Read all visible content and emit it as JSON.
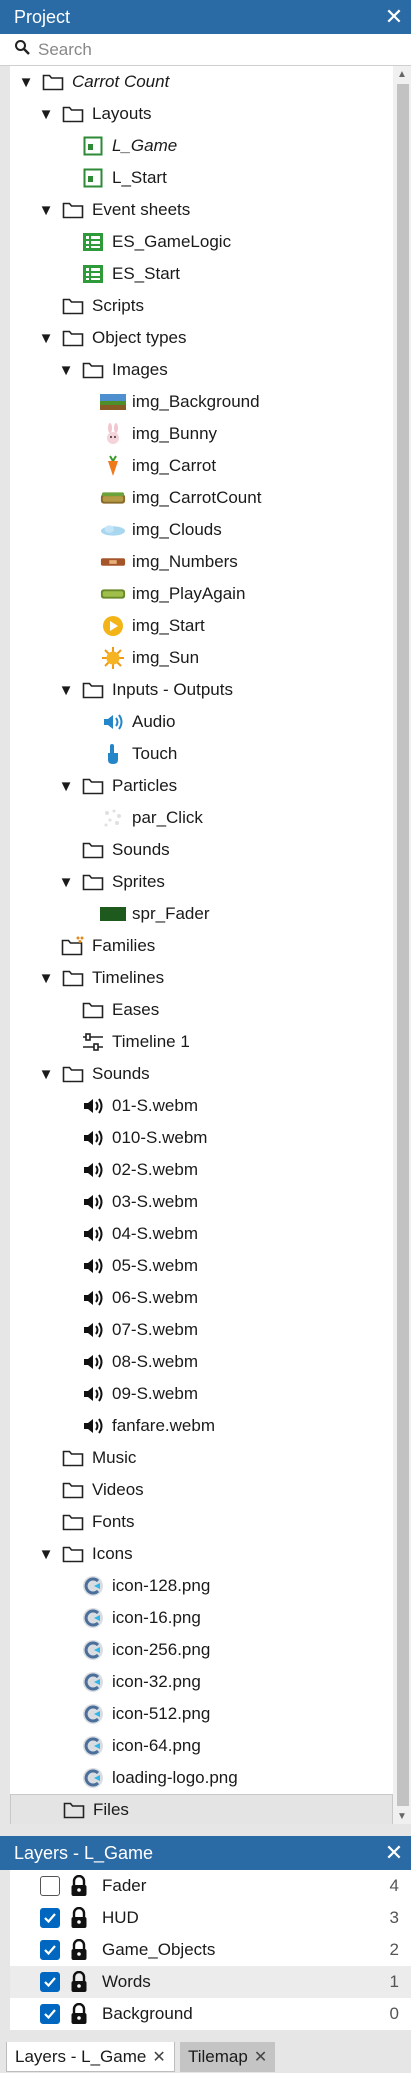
{
  "project_panel": {
    "title": "Project",
    "close_glyph": "✕",
    "search": {
      "placeholder": "Search",
      "value": ""
    }
  },
  "tree": [
    {
      "label": "Carrot Count",
      "icon": "folder-icon",
      "expanded": true,
      "italic": true
    },
    {
      "label": "Layouts",
      "icon": "folder-icon",
      "expanded": true
    },
    {
      "label": "L_Game",
      "icon": "layout-icon",
      "italic": true
    },
    {
      "label": "L_Start",
      "icon": "layout-icon"
    },
    {
      "label": "Event sheets",
      "icon": "folder-icon",
      "expanded": true
    },
    {
      "label": "ES_GameLogic",
      "icon": "event-sheet-icon"
    },
    {
      "label": "ES_Start",
      "icon": "event-sheet-icon"
    },
    {
      "label": "Scripts",
      "icon": "folder-icon"
    },
    {
      "label": "Object types",
      "icon": "folder-icon",
      "expanded": true
    },
    {
      "label": "Images",
      "icon": "folder-icon",
      "expanded": true
    },
    {
      "label": "img_Background",
      "icon": "background-thumbnail-icon"
    },
    {
      "label": "img_Bunny",
      "icon": "bunny-thumbnail-icon"
    },
    {
      "label": "img_Carrot",
      "icon": "carrot-thumbnail-icon"
    },
    {
      "label": "img_CarrotCount",
      "icon": "carrot-count-thumbnail-icon"
    },
    {
      "label": "img_Clouds",
      "icon": "clouds-thumbnail-icon"
    },
    {
      "label": "img_Numbers",
      "icon": "numbers-thumbnail-icon"
    },
    {
      "label": "img_PlayAgain",
      "icon": "play-again-thumbnail-icon"
    },
    {
      "label": "img_Start",
      "icon": "start-thumbnail-icon"
    },
    {
      "label": "img_Sun",
      "icon": "sun-thumbnail-icon"
    },
    {
      "label": "Inputs - Outputs",
      "icon": "folder-icon",
      "expanded": true
    },
    {
      "label": "Audio",
      "icon": "speaker-icon"
    },
    {
      "label": "Touch",
      "icon": "touch-icon"
    },
    {
      "label": "Particles",
      "icon": "folder-icon",
      "expanded": true
    },
    {
      "label": "par_Click",
      "icon": "particles-icon"
    },
    {
      "label": "Sounds",
      "icon": "folder-icon"
    },
    {
      "label": "Sprites",
      "icon": "folder-icon",
      "expanded": true
    },
    {
      "label": "spr_Fader",
      "icon": "fader-thumbnail-icon"
    },
    {
      "label": "Families",
      "icon": "families-folder-icon"
    },
    {
      "label": "Timelines",
      "icon": "folder-icon",
      "expanded": true
    },
    {
      "label": "Eases",
      "icon": "folder-icon"
    },
    {
      "label": "Timeline 1",
      "icon": "timeline-icon"
    },
    {
      "label": "Sounds",
      "icon": "folder-icon",
      "expanded": true
    },
    {
      "label": "01-S.webm",
      "icon": "sound-file-icon"
    },
    {
      "label": "010-S.webm",
      "icon": "sound-file-icon"
    },
    {
      "label": "02-S.webm",
      "icon": "sound-file-icon"
    },
    {
      "label": "03-S.webm",
      "icon": "sound-file-icon"
    },
    {
      "label": "04-S.webm",
      "icon": "sound-file-icon"
    },
    {
      "label": "05-S.webm",
      "icon": "sound-file-icon"
    },
    {
      "label": "06-S.webm",
      "icon": "sound-file-icon"
    },
    {
      "label": "07-S.webm",
      "icon": "sound-file-icon"
    },
    {
      "label": "08-S.webm",
      "icon": "sound-file-icon"
    },
    {
      "label": "09-S.webm",
      "icon": "sound-file-icon"
    },
    {
      "label": "fanfare.webm",
      "icon": "sound-file-icon"
    },
    {
      "label": "Music",
      "icon": "folder-icon"
    },
    {
      "label": "Videos",
      "icon": "folder-icon"
    },
    {
      "label": "Fonts",
      "icon": "folder-icon"
    },
    {
      "label": "Icons",
      "icon": "folder-icon",
      "expanded": true
    },
    {
      "label": "icon-128.png",
      "icon": "construct-logo-icon"
    },
    {
      "label": "icon-16.png",
      "icon": "construct-logo-icon"
    },
    {
      "label": "icon-256.png",
      "icon": "construct-logo-icon"
    },
    {
      "label": "icon-32.png",
      "icon": "construct-logo-icon"
    },
    {
      "label": "icon-512.png",
      "icon": "construct-logo-icon"
    },
    {
      "label": "icon-64.png",
      "icon": "construct-logo-icon"
    },
    {
      "label": "loading-logo.png",
      "icon": "construct-logo-icon"
    },
    {
      "label": "Files",
      "icon": "folder-icon",
      "selected": true
    }
  ],
  "layers_panel": {
    "title": "Layers - L_Game",
    "close_glyph": "✕",
    "layers": [
      {
        "name": "Fader",
        "index": "4",
        "visible": false,
        "locked": true
      },
      {
        "name": "HUD",
        "index": "3",
        "visible": true,
        "locked": true
      },
      {
        "name": "Game_Objects",
        "index": "2",
        "visible": true,
        "locked": true
      },
      {
        "name": "Words",
        "index": "1",
        "visible": true,
        "locked": true,
        "selected": true
      },
      {
        "name": "Background",
        "index": "0",
        "visible": true,
        "locked": true
      }
    ]
  },
  "tabs": [
    {
      "label": "Layers - L_Game",
      "active": true
    },
    {
      "label": "Tilemap",
      "active": false
    }
  ],
  "colors": {
    "header": "#2b6ba5",
    "checkbox": "#0067c0",
    "event_sheet": "#2e9a3a"
  }
}
